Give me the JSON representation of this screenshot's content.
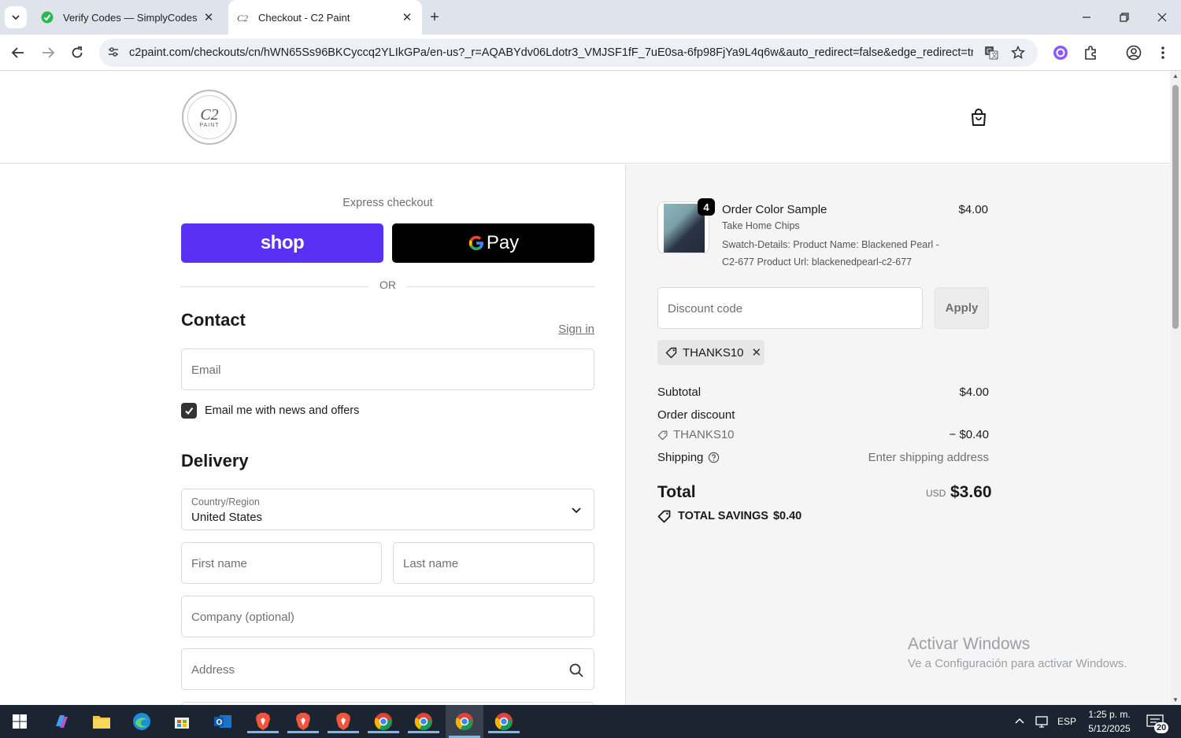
{
  "browser": {
    "tabs": [
      {
        "title": "Verify Codes — SimplyCodes",
        "active": false
      },
      {
        "title": "Checkout - C2 Paint",
        "active": true
      }
    ],
    "url": "c2paint.com/checkouts/cn/hWN65Ss96BKCyccq2YLIkGPa/en-us?_r=AQABYdv06Ldotr3_VMJSF1fF_7uE0sa-6fp98FjYa9L4q6w&auto_redirect=false&edge_redirect=true..."
  },
  "store": {
    "logo_text": "C2",
    "logo_sub": "PAINT"
  },
  "checkout": {
    "express_label": "Express checkout",
    "shop_label": "shop",
    "gpay_g": "G",
    "gpay_label": "Pay",
    "or_label": "OR",
    "contact": {
      "heading": "Contact",
      "signin": "Sign in",
      "email_placeholder": "Email",
      "newsletter_label": "Email me with news and offers",
      "newsletter_checked": true
    },
    "delivery": {
      "heading": "Delivery",
      "country_label": "Country/Region",
      "country_value": "United States",
      "first_name_placeholder": "First name",
      "last_name_placeholder": "Last name",
      "company_placeholder": "Company (optional)",
      "address_placeholder": "Address"
    }
  },
  "summary": {
    "item": {
      "quantity": "4",
      "name": "Order Color Sample",
      "subtitle": "Take Home Chips",
      "details": "Swatch-Details: Product Name: Blackened Pearl - C2-677 Product Url: blackenedpearl-c2-677",
      "price": "$4.00"
    },
    "discount_placeholder": "Discount code",
    "apply_label": "Apply",
    "applied_code": "THANKS10",
    "subtotal_label": "Subtotal",
    "subtotal_value": "$4.00",
    "order_discount_label": "Order discount",
    "discount_code_label": "THANKS10",
    "discount_value": "− $0.40",
    "shipping_label": "Shipping",
    "shipping_value": "Enter shipping address",
    "total_label": "Total",
    "total_currency": "USD",
    "total_value": "$3.60",
    "savings_label": "TOTAL SAVINGS",
    "savings_value": "$0.40"
  },
  "watermark": {
    "line1": "Activar Windows",
    "line2": "Ve a Configuración para activar Windows."
  },
  "taskbar": {
    "language": "ESP",
    "time": "1:25 p. m.",
    "date": "5/12/2025",
    "notifications": "20"
  }
}
